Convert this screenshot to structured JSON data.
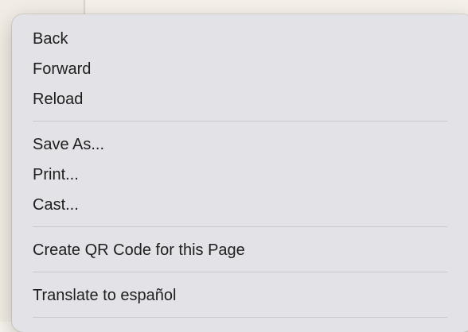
{
  "context_menu": {
    "groups": [
      [
        "Back",
        "Forward",
        "Reload"
      ],
      [
        "Save As...",
        "Print...",
        "Cast..."
      ],
      [
        "Create QR Code for this Page"
      ],
      [
        "Translate to español"
      ]
    ]
  }
}
